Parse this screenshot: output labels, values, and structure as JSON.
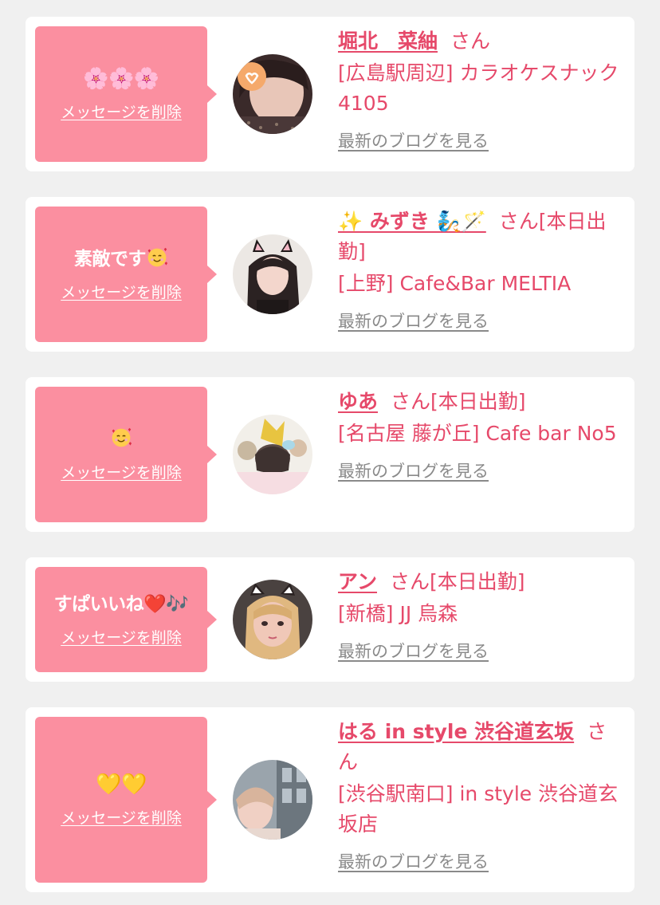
{
  "messages": [
    {
      "message": "🌸🌸🌸",
      "delete_label": "メッセージを削除",
      "name": "堀北　菜紬",
      "honorific": "さん",
      "shop": "[広島駅周辺] カラオケスナック 4105",
      "blog_label": "最新のブログを見る"
    },
    {
      "message": "素敵です",
      "message_emoji": "smiling-face-with-hearts-icon",
      "delete_label": "メッセージを削除",
      "name": "✨ みずき 🧞🪄",
      "honorific": "さん[本日出勤]",
      "shop": "[上野] Cafe&Bar MELTIA",
      "blog_label": "最新のブログを見る"
    },
    {
      "message": "",
      "message_emoji": "smiling-face-with-hearts-icon",
      "delete_label": "メッセージを削除",
      "name": "ゆあ",
      "honorific": "さん[本日出勤]",
      "shop": "[名古屋 藤が丘] Cafe bar No5",
      "blog_label": "最新のブログを見る"
    },
    {
      "message": "すぱいいね❤️🎶",
      "delete_label": "メッセージを削除",
      "name": "アン",
      "honorific": "さん[本日出勤]",
      "shop": "[新橋] JJ 烏森",
      "blog_label": "最新のブログを見る"
    },
    {
      "message": "💛💛",
      "delete_label": "メッセージを削除",
      "name": "はる in style 渋谷道玄坂",
      "honorific": "さん",
      "shop": "[渋谷駅南口] in style 渋谷道玄坂店",
      "blog_label": "最新のブログを見る"
    }
  ],
  "colors": {
    "bubble": "#fb8fa0",
    "accent_text": "#e6496a",
    "muted_link": "#8a8a8a",
    "background": "#f0f0f0"
  }
}
